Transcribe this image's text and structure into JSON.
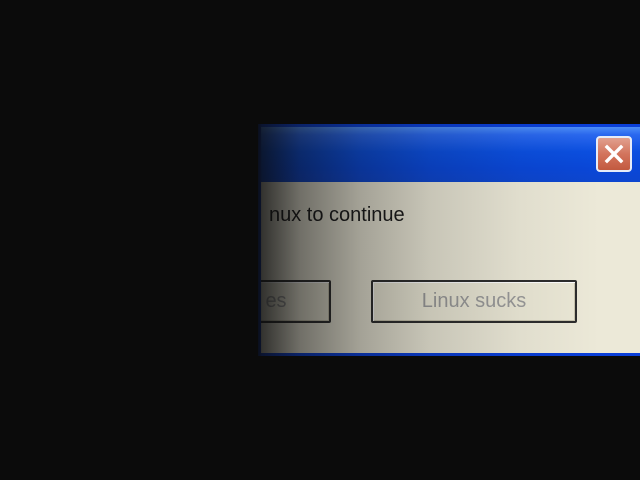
{
  "dialog": {
    "message": "nux to continue",
    "buttons": {
      "left_label": "es",
      "right_label": "Linux sucks"
    },
    "close_icon": "close-x-icon"
  },
  "colors": {
    "background": "#0b0b0b",
    "titlebar": "#0a47d8",
    "dialog_body": "#ece9d8",
    "close_button": "#c25a40"
  }
}
